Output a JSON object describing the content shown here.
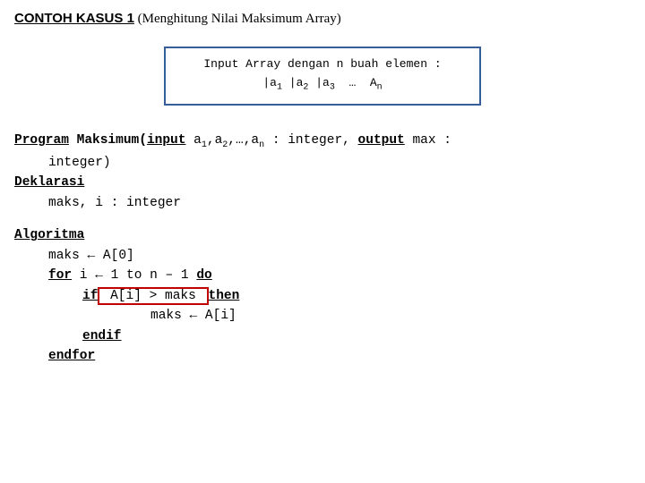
{
  "title": {
    "bold": "CONTOH KASUS 1",
    "rest": " (Menghitung Nilai Maksimum Array)"
  },
  "input_box": {
    "line1": "Input Array dengan n buah elemen :",
    "a1": "a",
    "s1": "1",
    "a2": "a",
    "s2": "2",
    "a3": "a",
    "s3": "3",
    "dots": "…",
    "an": "A",
    "sn": "n"
  },
  "prog": {
    "kw_program": "Program",
    "name": " Maksimum(",
    "kw_input": "input",
    "params1": "  a",
    "p_s1": "1",
    "comma1": ",a",
    "p_s2": "2",
    "comma2": ",…,a",
    "p_sn": "n",
    "params2": " : integer, ",
    "kw_output": "output",
    "params3": " max :",
    "line2": "integer)",
    "kw_deklarasi": "Deklarasi",
    "decl": "maks, i    : integer",
    "kw_algoritma": "Algoritma",
    "alg1a": "maks ",
    "arrow": "←",
    "alg1b": " A[0]",
    "kw_for": "for",
    "for_mid": " i ",
    "for_arrow": "←",
    "for_rest": " 1 to n – 1 ",
    "kw_do": "do",
    "kw_if": "if",
    "if_cond": " A[i] > maks ",
    "kw_then": "then",
    "body_a": "maks ",
    "body_arrow": "←",
    "body_b": " A[i]",
    "kw_endif": "endif",
    "kw_endfor": "endfor"
  }
}
